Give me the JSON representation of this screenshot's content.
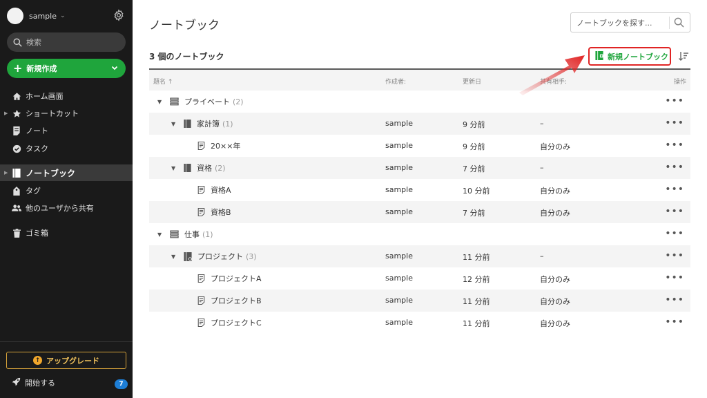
{
  "account": {
    "name": "sample"
  },
  "search": {
    "placeholder": "検索"
  },
  "new_button": {
    "label": "新規作成"
  },
  "nav": {
    "home": "ホーム画面",
    "shortcuts": "ショートカット",
    "notes": "ノート",
    "tasks": "タスク",
    "notebooks": "ノートブック",
    "tags": "タグ",
    "shared": "他のユーザから共有",
    "trash": "ゴミ箱"
  },
  "upgrade": {
    "label": "アップグレード"
  },
  "getting_started": {
    "label": "開始する",
    "badge": "7"
  },
  "main": {
    "title": "ノートブック",
    "search_placeholder": "ノートブックを探す...",
    "count_label": "3 個のノートブック",
    "new_notebook_label": "新規ノートブック"
  },
  "table": {
    "headers": {
      "title": "題名 ↑",
      "creator": "作成者:",
      "updated": "更新日",
      "shared": "共有相手:",
      "actions": "操作"
    },
    "rows": [
      {
        "name": "プライベート",
        "count": "(2)",
        "creator": "",
        "updated": "",
        "shared": ""
      },
      {
        "name": "家計簿",
        "count": "(1)",
        "creator": "sample",
        "updated": "9 分前",
        "shared": "–"
      },
      {
        "name": "20××年",
        "count": "",
        "creator": "sample",
        "updated": "9 分前",
        "shared": "自分のみ"
      },
      {
        "name": "資格",
        "count": "(2)",
        "creator": "sample",
        "updated": "7 分前",
        "shared": "–"
      },
      {
        "name": "資格A",
        "count": "",
        "creator": "sample",
        "updated": "10 分前",
        "shared": "自分のみ"
      },
      {
        "name": "資格B",
        "count": "",
        "creator": "sample",
        "updated": "7 分前",
        "shared": "自分のみ"
      },
      {
        "name": "仕事",
        "count": "(1)",
        "creator": "",
        "updated": "",
        "shared": ""
      },
      {
        "name": "プロジェクト",
        "count": "(3)",
        "creator": "sample",
        "updated": "11 分前",
        "shared": "–"
      },
      {
        "name": "プロジェクトA",
        "count": "",
        "creator": "sample",
        "updated": "12 分前",
        "shared": "自分のみ"
      },
      {
        "name": "プロジェクトB",
        "count": "",
        "creator": "sample",
        "updated": "11 分前",
        "shared": "自分のみ"
      },
      {
        "name": "プロジェクトC",
        "count": "",
        "creator": "sample",
        "updated": "11 分前",
        "shared": "自分のみ"
      }
    ],
    "more_icon": "•••"
  },
  "colors": {
    "sidebar": "#1a1a1a",
    "accent_green": "#1fa53c",
    "highlight_red": "#e02424",
    "upgrade_gold": "#f1c25c",
    "badge_blue": "#1d7ed6"
  }
}
